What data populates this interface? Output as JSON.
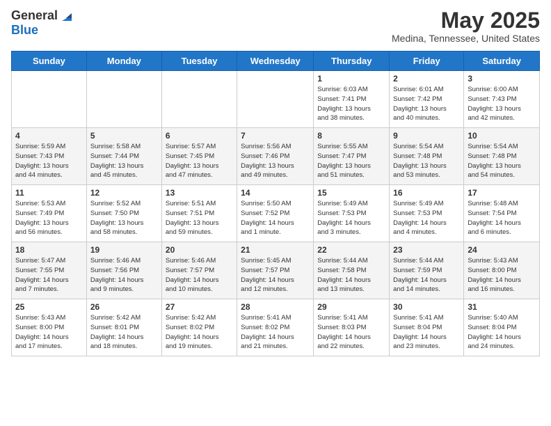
{
  "header": {
    "logo_general": "General",
    "logo_blue": "Blue",
    "month_title": "May 2025",
    "location": "Medina, Tennessee, United States"
  },
  "weekdays": [
    "Sunday",
    "Monday",
    "Tuesday",
    "Wednesday",
    "Thursday",
    "Friday",
    "Saturday"
  ],
  "rows": [
    [
      {
        "day": "",
        "info": ""
      },
      {
        "day": "",
        "info": ""
      },
      {
        "day": "",
        "info": ""
      },
      {
        "day": "",
        "info": ""
      },
      {
        "day": "1",
        "info": "Sunrise: 6:03 AM\nSunset: 7:41 PM\nDaylight: 13 hours\nand 38 minutes."
      },
      {
        "day": "2",
        "info": "Sunrise: 6:01 AM\nSunset: 7:42 PM\nDaylight: 13 hours\nand 40 minutes."
      },
      {
        "day": "3",
        "info": "Sunrise: 6:00 AM\nSunset: 7:43 PM\nDaylight: 13 hours\nand 42 minutes."
      }
    ],
    [
      {
        "day": "4",
        "info": "Sunrise: 5:59 AM\nSunset: 7:43 PM\nDaylight: 13 hours\nand 44 minutes."
      },
      {
        "day": "5",
        "info": "Sunrise: 5:58 AM\nSunset: 7:44 PM\nDaylight: 13 hours\nand 45 minutes."
      },
      {
        "day": "6",
        "info": "Sunrise: 5:57 AM\nSunset: 7:45 PM\nDaylight: 13 hours\nand 47 minutes."
      },
      {
        "day": "7",
        "info": "Sunrise: 5:56 AM\nSunset: 7:46 PM\nDaylight: 13 hours\nand 49 minutes."
      },
      {
        "day": "8",
        "info": "Sunrise: 5:55 AM\nSunset: 7:47 PM\nDaylight: 13 hours\nand 51 minutes."
      },
      {
        "day": "9",
        "info": "Sunrise: 5:54 AM\nSunset: 7:48 PM\nDaylight: 13 hours\nand 53 minutes."
      },
      {
        "day": "10",
        "info": "Sunrise: 5:54 AM\nSunset: 7:48 PM\nDaylight: 13 hours\nand 54 minutes."
      }
    ],
    [
      {
        "day": "11",
        "info": "Sunrise: 5:53 AM\nSunset: 7:49 PM\nDaylight: 13 hours\nand 56 minutes."
      },
      {
        "day": "12",
        "info": "Sunrise: 5:52 AM\nSunset: 7:50 PM\nDaylight: 13 hours\nand 58 minutes."
      },
      {
        "day": "13",
        "info": "Sunrise: 5:51 AM\nSunset: 7:51 PM\nDaylight: 13 hours\nand 59 minutes."
      },
      {
        "day": "14",
        "info": "Sunrise: 5:50 AM\nSunset: 7:52 PM\nDaylight: 14 hours\nand 1 minute."
      },
      {
        "day": "15",
        "info": "Sunrise: 5:49 AM\nSunset: 7:53 PM\nDaylight: 14 hours\nand 3 minutes."
      },
      {
        "day": "16",
        "info": "Sunrise: 5:49 AM\nSunset: 7:53 PM\nDaylight: 14 hours\nand 4 minutes."
      },
      {
        "day": "17",
        "info": "Sunrise: 5:48 AM\nSunset: 7:54 PM\nDaylight: 14 hours\nand 6 minutes."
      }
    ],
    [
      {
        "day": "18",
        "info": "Sunrise: 5:47 AM\nSunset: 7:55 PM\nDaylight: 14 hours\nand 7 minutes."
      },
      {
        "day": "19",
        "info": "Sunrise: 5:46 AM\nSunset: 7:56 PM\nDaylight: 14 hours\nand 9 minutes."
      },
      {
        "day": "20",
        "info": "Sunrise: 5:46 AM\nSunset: 7:57 PM\nDaylight: 14 hours\nand 10 minutes."
      },
      {
        "day": "21",
        "info": "Sunrise: 5:45 AM\nSunset: 7:57 PM\nDaylight: 14 hours\nand 12 minutes."
      },
      {
        "day": "22",
        "info": "Sunrise: 5:44 AM\nSunset: 7:58 PM\nDaylight: 14 hours\nand 13 minutes."
      },
      {
        "day": "23",
        "info": "Sunrise: 5:44 AM\nSunset: 7:59 PM\nDaylight: 14 hours\nand 14 minutes."
      },
      {
        "day": "24",
        "info": "Sunrise: 5:43 AM\nSunset: 8:00 PM\nDaylight: 14 hours\nand 16 minutes."
      }
    ],
    [
      {
        "day": "25",
        "info": "Sunrise: 5:43 AM\nSunset: 8:00 PM\nDaylight: 14 hours\nand 17 minutes."
      },
      {
        "day": "26",
        "info": "Sunrise: 5:42 AM\nSunset: 8:01 PM\nDaylight: 14 hours\nand 18 minutes."
      },
      {
        "day": "27",
        "info": "Sunrise: 5:42 AM\nSunset: 8:02 PM\nDaylight: 14 hours\nand 19 minutes."
      },
      {
        "day": "28",
        "info": "Sunrise: 5:41 AM\nSunset: 8:02 PM\nDaylight: 14 hours\nand 21 minutes."
      },
      {
        "day": "29",
        "info": "Sunrise: 5:41 AM\nSunset: 8:03 PM\nDaylight: 14 hours\nand 22 minutes."
      },
      {
        "day": "30",
        "info": "Sunrise: 5:41 AM\nSunset: 8:04 PM\nDaylight: 14 hours\nand 23 minutes."
      },
      {
        "day": "31",
        "info": "Sunrise: 5:40 AM\nSunset: 8:04 PM\nDaylight: 14 hours\nand 24 minutes."
      }
    ]
  ]
}
